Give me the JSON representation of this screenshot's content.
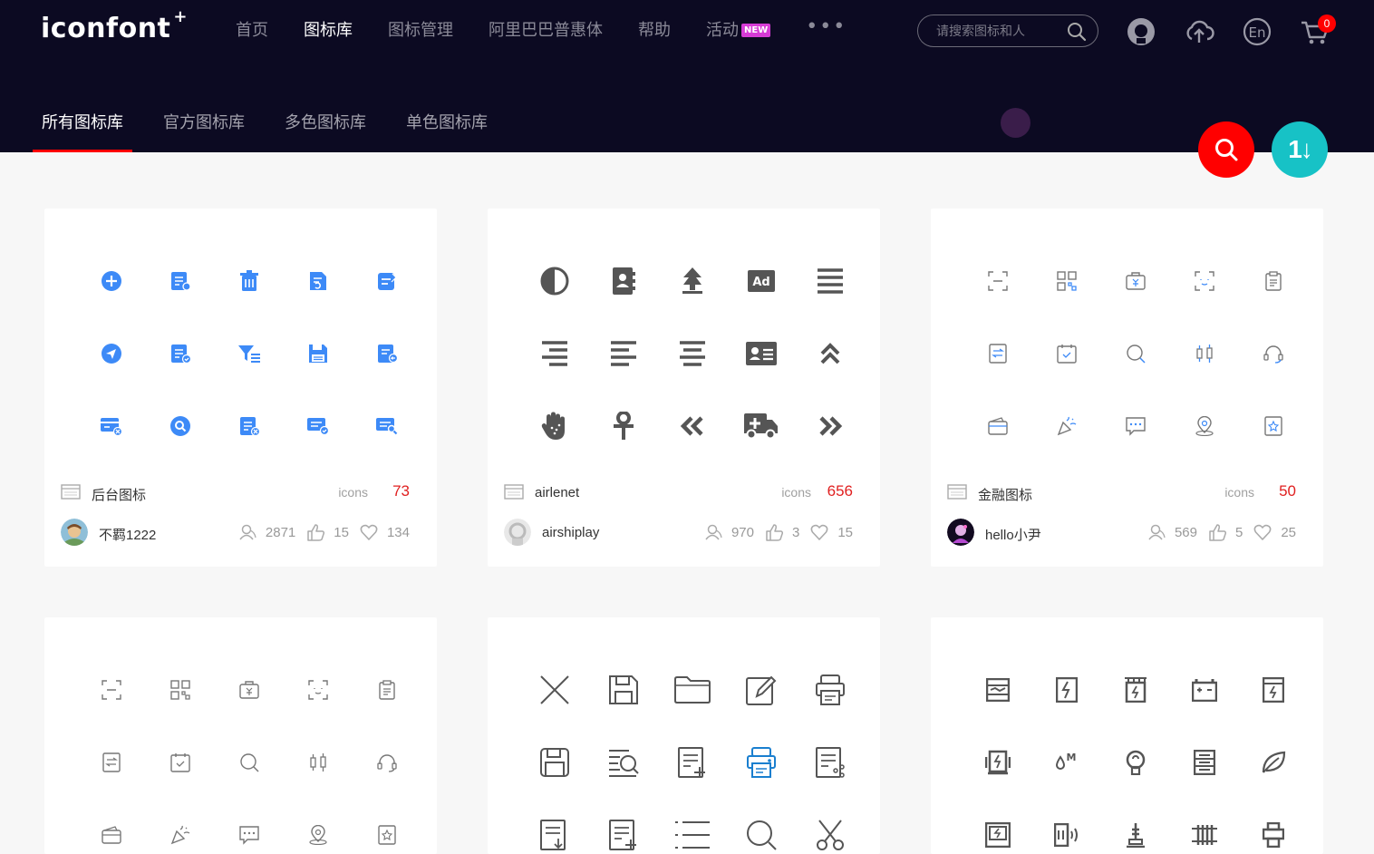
{
  "header": {
    "logo": "iconfont",
    "logo_plus": "+",
    "nav": [
      "首页",
      "图标库",
      "图标管理",
      "阿里巴巴普惠体",
      "帮助",
      "活动"
    ],
    "new_badge": "NEW",
    "more": "•••",
    "search_placeholder": "请搜索图标和人",
    "cart_count": "0",
    "icons": [
      "github-icon",
      "upload-cloud-icon",
      "language-en-icon",
      "cart-icon"
    ]
  },
  "subtabs": [
    "所有图标库",
    "官方图标库",
    "多色图标库",
    "单色图标库"
  ],
  "fab": {
    "search": "search-icon",
    "sort": "1↓"
  },
  "colors": {
    "header_bg": "#0c0a22",
    "accent_red": "#ff0000",
    "teal": "#17c2c6",
    "blue_icon": "#3d8af7",
    "gray_icon": "#555555"
  },
  "cards": [
    {
      "name": "后台图标",
      "icons_label": "icons",
      "icons_count": "73",
      "author": "不羁1222",
      "views": "2871",
      "likes": "15",
      "favorites": "134"
    },
    {
      "name": "airlenet",
      "icons_label": "icons",
      "icons_count": "656",
      "author": "airshiplay",
      "views": "970",
      "likes": "3",
      "favorites": "15"
    },
    {
      "name": "金融图标",
      "icons_label": "icons",
      "icons_count": "50",
      "author": "hello小尹",
      "views": "569",
      "likes": "5",
      "favorites": "25"
    }
  ]
}
